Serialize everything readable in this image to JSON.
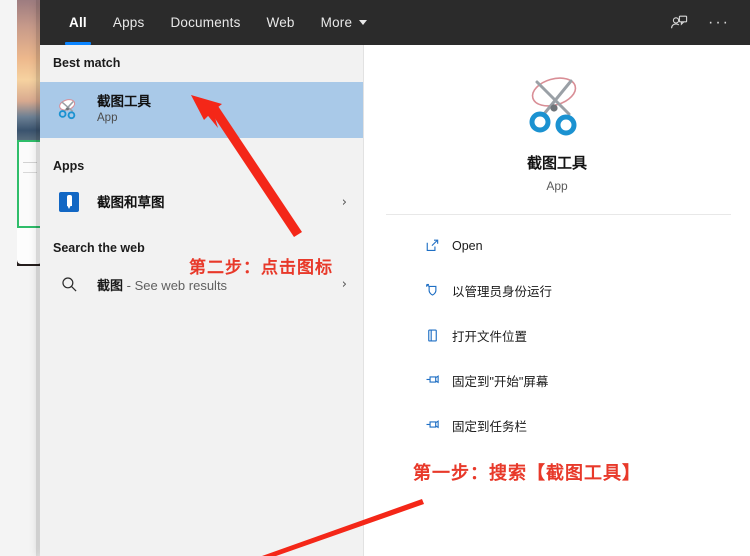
{
  "header": {
    "tabs": [
      {
        "label": "All",
        "active": true
      },
      {
        "label": "Apps",
        "active": false
      },
      {
        "label": "Documents",
        "active": false
      },
      {
        "label": "Web",
        "active": false
      },
      {
        "label": "More",
        "active": false,
        "has_caret": true
      }
    ],
    "feedback_icon": "feedback-person-icon",
    "overflow_icon": "ellipsis-icon",
    "overflow_label": "···",
    "background_color": "#2b2b2b",
    "accent_color": "#0a84ff"
  },
  "left": {
    "best_match": {
      "section_label": "Best match",
      "item": {
        "icon": "snipping-tool-icon",
        "title": "截图工具",
        "subtitle": "App",
        "highlight_color": "#a9c9e8"
      }
    },
    "apps": {
      "section_label": "Apps",
      "items": [
        {
          "icon": "snip-and-sketch-icon",
          "title": "截图和草图",
          "chevron": "›"
        }
      ]
    },
    "search_web": {
      "section_label": "Search the web",
      "items": [
        {
          "icon": "search-icon",
          "query": "截图",
          "suffix": " - See web results",
          "chevron": "›"
        }
      ]
    }
  },
  "right": {
    "preview": {
      "icon": "snipping-tool-icon",
      "name": "截图工具",
      "type": "App"
    },
    "actions": [
      {
        "icon": "open-external-icon",
        "label": "Open"
      },
      {
        "icon": "shield-admin-icon",
        "label": "以管理员身份运行"
      },
      {
        "icon": "folder-location-icon",
        "label": "打开文件位置"
      },
      {
        "icon": "pin-icon",
        "label": "固定到\"开始\"屏幕"
      },
      {
        "icon": "pin-icon",
        "label": "固定到任务栏"
      }
    ]
  },
  "annotations": {
    "step2": {
      "text": "第二步：点击图标",
      "color": "#e8392a"
    },
    "step1": {
      "text": "第一步：搜索【截图工具】",
      "color": "#e8392a"
    },
    "arrow_upper": "red-arrow-pointing-to-app-icon",
    "arrow_lower": "red-arrow-pointing-to-search-box"
  }
}
